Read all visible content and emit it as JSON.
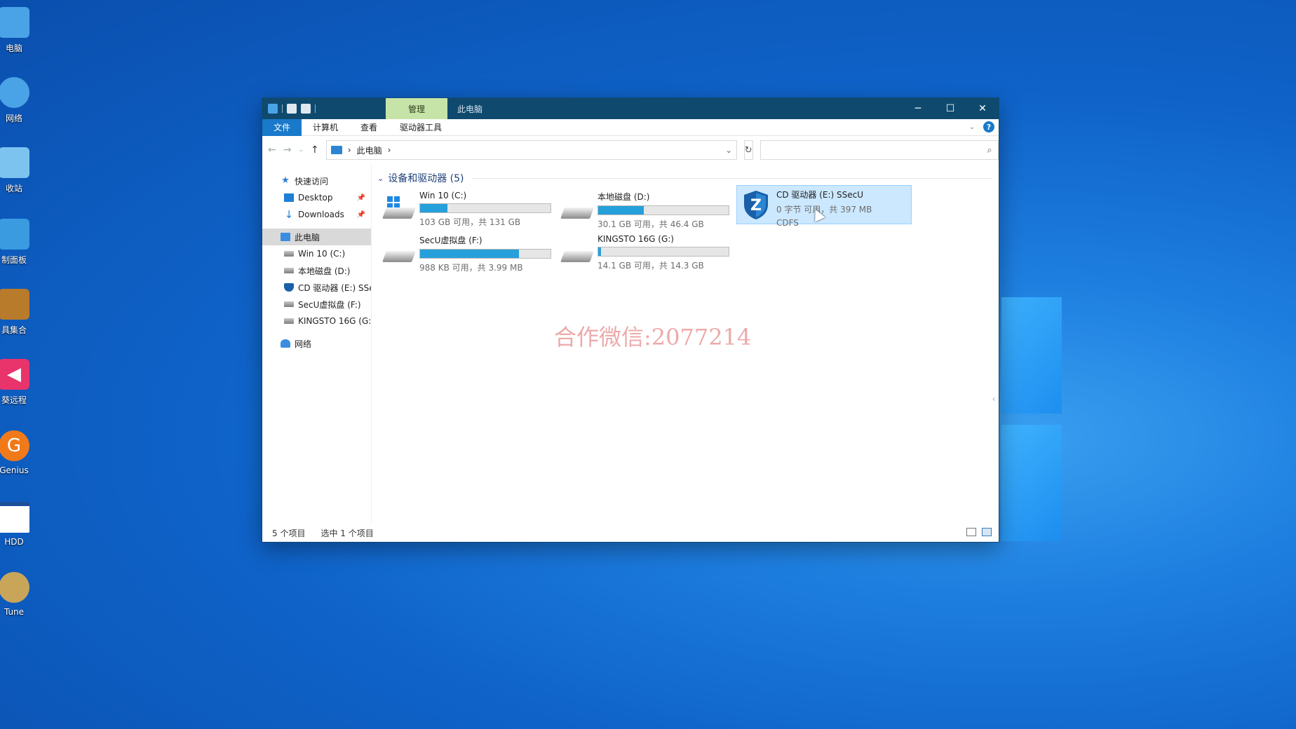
{
  "desktop": {
    "icons": [
      {
        "label": "电脑",
        "icon": "computer-icon",
        "color": "#4aa3e6"
      },
      {
        "label": "网络",
        "icon": "network-icon",
        "color": "#4aa3e6"
      },
      {
        "label": "收站",
        "icon": "recycle-bin-icon",
        "color": "#7cc3ef"
      },
      {
        "label": "制面板",
        "icon": "control-panel-icon",
        "color": "#3a9be0"
      },
      {
        "label": "具集合",
        "icon": "toolbox-icon",
        "color": "#b87a2b"
      },
      {
        "label": "葵远程",
        "icon": "remote-icon",
        "color": "#e8336b"
      },
      {
        "label": "Genius",
        "icon": "genius-icon",
        "color": "#f07a1a"
      },
      {
        "label": "HDD",
        "icon": "hdd-window-icon",
        "color": "#ffffff"
      },
      {
        "label": "Tune",
        "icon": "tune-icon",
        "color": "#c9a55a"
      }
    ]
  },
  "window": {
    "context_tab": "管理",
    "title": "此电脑",
    "controls": {
      "minimize": "─",
      "maximize": "☐",
      "close": "✕"
    },
    "ribbon_tabs": [
      "文件",
      "计算机",
      "查看",
      "驱动器工具"
    ],
    "help": "?",
    "address": {
      "path": "此电脑",
      "sep": "›"
    },
    "search": {
      "placeholder": ""
    },
    "nav": {
      "quick_access": "快速访问",
      "desktop": "Desktop",
      "downloads": "Downloads",
      "this_pc": "此电脑",
      "drives": [
        "Win 10 (C:)",
        "本地磁盘 (D:)",
        "CD 驱动器 (E:) SSe",
        "SecU虚拟盘 (F:)",
        "KINGSTO 16G (G:"
      ],
      "network": "网络"
    },
    "group": {
      "title": "设备和驱动器 (5)"
    },
    "drives": [
      {
        "name": "Win 10 (C:)",
        "info": "103 GB 可用，共 131 GB",
        "used_fraction": 0.21
      },
      {
        "name": "本地磁盘 (D:)",
        "info": "30.1 GB 可用，共 46.4 GB",
        "used_fraction": 0.35
      },
      {
        "name": "CD 驱动器 (E:) SSecU",
        "info": "0 字节 可用，共 397 MB",
        "fs": "CDFS"
      },
      {
        "name": "SecU虚拟盘 (F:)",
        "info": "988 KB 可用，共 3.99 MB",
        "used_fraction": 0.76
      },
      {
        "name": "KINGSTO 16G (G:)",
        "info": "14.1 GB 可用，共 14.3 GB",
        "used_fraction": 0.02
      }
    ],
    "watermark": "合作微信:2077214",
    "status": {
      "count": "5 个项目",
      "selected": "选中 1 个项目"
    }
  }
}
